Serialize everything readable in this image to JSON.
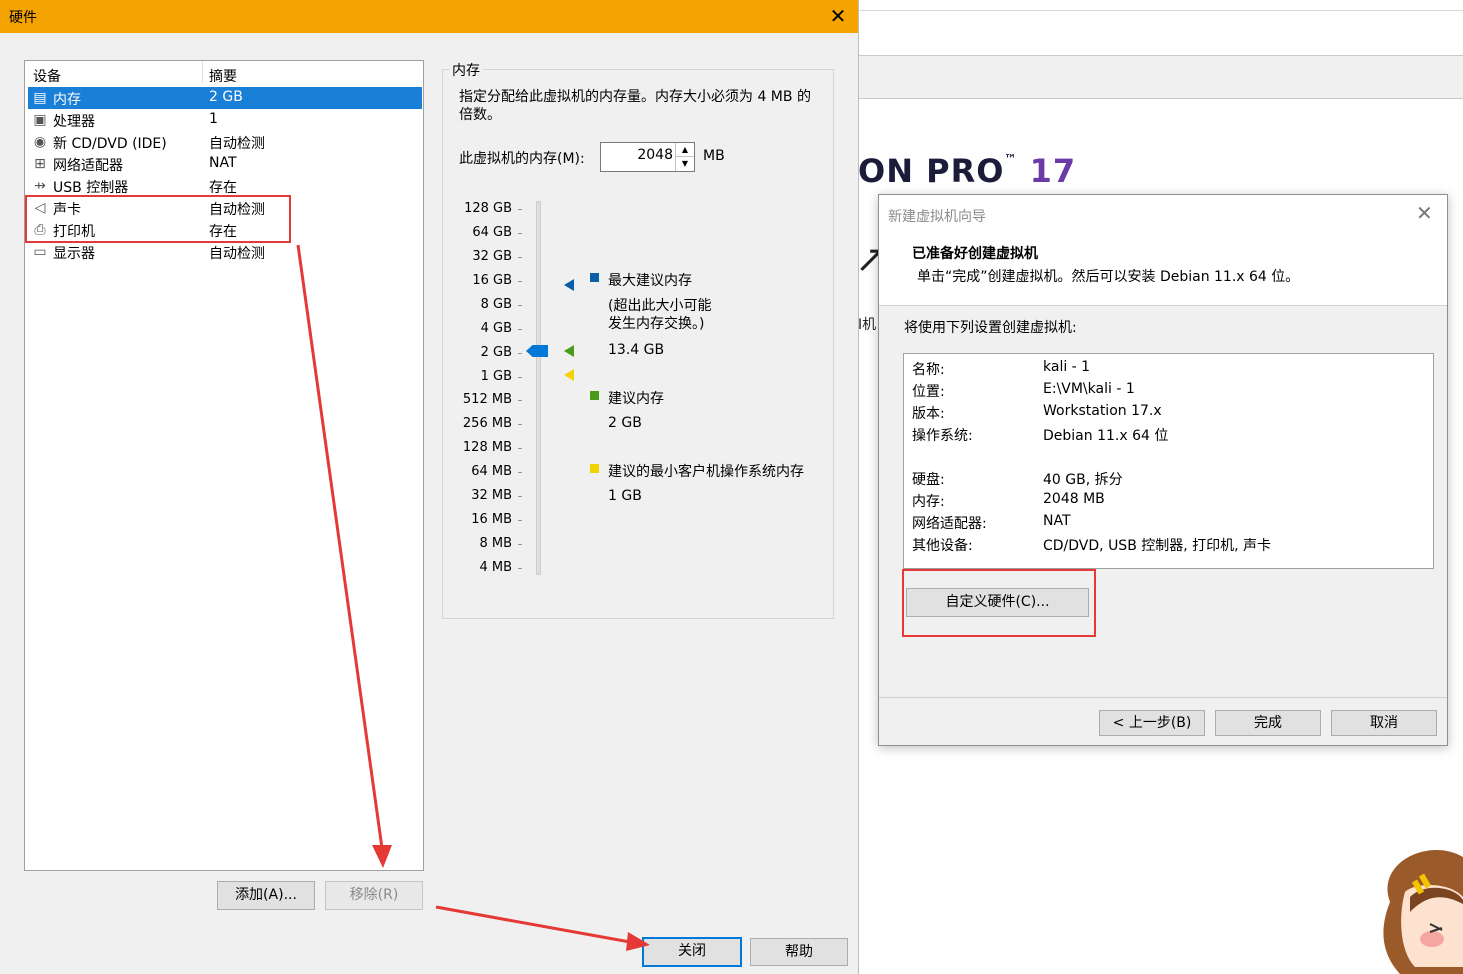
{
  "hardware_dialog": {
    "title": "硬件",
    "close_glyph": "✕",
    "columns": {
      "device": "设备",
      "summary": "摘要"
    },
    "devices": [
      {
        "icon": "memory-icon",
        "name": "内存",
        "summary": "2 GB",
        "selected": true
      },
      {
        "icon": "processor-icon",
        "name": "处理器",
        "summary": "1"
      },
      {
        "icon": "cd-dvd-icon",
        "name": "新 CD/DVD (IDE)",
        "summary": "自动检测"
      },
      {
        "icon": "network-adapter-icon",
        "name": "网络适配器",
        "summary": "NAT"
      },
      {
        "icon": "usb-icon",
        "name": "USB 控制器",
        "summary": "存在"
      },
      {
        "icon": "speaker-icon",
        "name": "声卡",
        "summary": "自动检测"
      },
      {
        "icon": "printer-icon",
        "name": "打印机",
        "summary": "存在"
      },
      {
        "icon": "display-icon",
        "name": "显示器",
        "summary": "自动检测"
      }
    ],
    "add_button": "添加(A)...",
    "remove_button": "移除(R)",
    "close_button": "关闭",
    "help_button": "帮助",
    "memory": {
      "group_label": "内存",
      "description": "指定分配给此虚拟机的内存量。内存大小必须为 4 MB 的倍数。",
      "field_label": "此虚拟机的内存(M):",
      "value": "2048",
      "unit": "MB",
      "scale_labels": [
        "128 GB",
        "64 GB",
        "32 GB",
        "16 GB",
        "8 GB",
        "4 GB",
        "2 GB",
        "1 GB",
        "512 MB",
        "256 MB",
        "128 MB",
        "64 MB",
        "32 MB",
        "16 MB",
        "8 MB",
        "4 MB"
      ],
      "legend": {
        "max_label": "最大建议内存",
        "max_note": "(超出此大小可能\n发生内存交换。)",
        "max_value": "13.4 GB",
        "rec_label": "建议内存",
        "rec_value": "2 GB",
        "min_label": "建议的最小客户机操作系统内存",
        "min_value": "1 GB"
      },
      "colors": {
        "max": "#0a5fa8",
        "rec": "#4a9a1c",
        "min": "#f2d200",
        "thumb": "#0078d7"
      }
    }
  },
  "background_app": {
    "logo_text": "ON PRO",
    "logo_tm": "™",
    "logo_version": "17",
    "partial_text": "I机"
  },
  "wizard": {
    "title": "新建虚拟机向导",
    "close_glyph": "✕",
    "heading": "已准备好创建虚拟机",
    "subheading": "单击“完成”创建虚拟机。然后可以安装 Debian 11.x 64 位。",
    "intro": "将使用下列设置创建虚拟机:",
    "settings": [
      {
        "key": "名称:",
        "value": "kali - 1"
      },
      {
        "key": "位置:",
        "value": "E:\\VM\\kali - 1"
      },
      {
        "key": "版本:",
        "value": "Workstation 17.x"
      },
      {
        "key": "操作系统:",
        "value": "Debian 11.x 64 位"
      },
      {
        "key": "硬盘:",
        "value": "40 GB, 拆分"
      },
      {
        "key": "内存:",
        "value": "2048 MB"
      },
      {
        "key": "网络适配器:",
        "value": "NAT"
      },
      {
        "key": "其他设备:",
        "value": "CD/DVD, USB 控制器, 打印机, 声卡"
      }
    ],
    "customize_button": "自定义硬件(C)...",
    "back_button": "< 上一步(B)",
    "finish_button": "完成",
    "cancel_button": "取消"
  },
  "annotation_colors": {
    "red": "#e53935"
  }
}
